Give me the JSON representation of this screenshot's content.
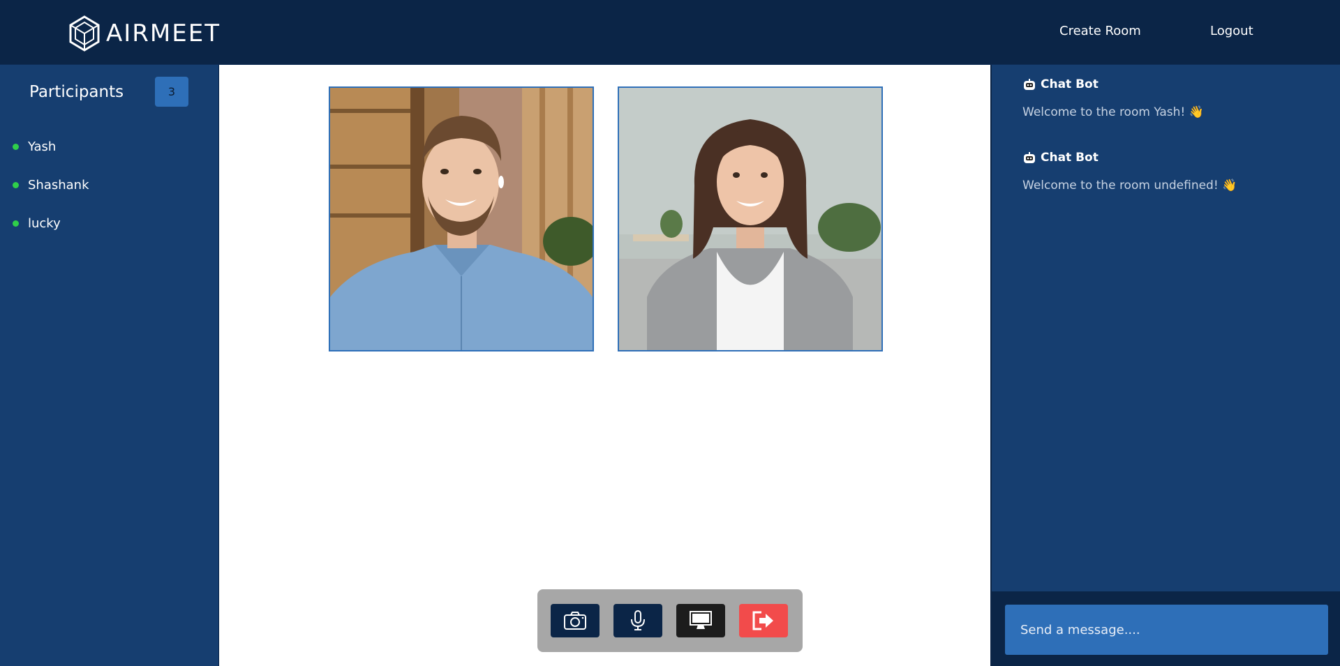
{
  "header": {
    "brand": "AIRMEET",
    "nav": {
      "create_room": "Create Room",
      "logout": "Logout"
    }
  },
  "sidebar": {
    "title": "Participants",
    "count": "3",
    "participants": [
      {
        "name": "Yash"
      },
      {
        "name": "Shashank"
      },
      {
        "name": "lucky"
      }
    ]
  },
  "main": {
    "videos": [
      {
        "label": "participant-video-man"
      },
      {
        "label": "participant-video-woman"
      }
    ]
  },
  "controls": {
    "camera_icon": "camera-icon",
    "mic_icon": "microphone-icon",
    "screen_icon": "monitor-icon",
    "leave_icon": "leave-icon"
  },
  "chat": {
    "messages": [
      {
        "sender": "Chat Bot",
        "text": "Welcome to the room Yash! 👋"
      },
      {
        "sender": "Chat Bot",
        "text": "Welcome to the room undefined! 👋"
      }
    ],
    "input_placeholder": "Send a message...."
  },
  "colors": {
    "header_bg": "#0b2547",
    "panel_bg": "#163e70",
    "accent": "#2e6fb8",
    "online": "#2fcf4a",
    "danger": "#f24b4b"
  }
}
